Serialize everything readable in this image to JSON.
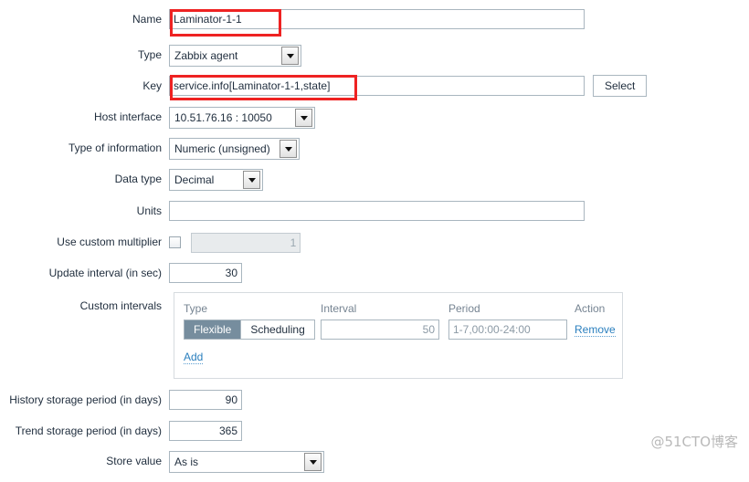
{
  "form": {
    "rows": [
      {
        "label": "Name",
        "value": "Laminator-1-1"
      },
      {
        "label": "Type",
        "value": "Zabbix agent"
      },
      {
        "label": "Key",
        "value": "service.info[Laminator-1-1,state]"
      },
      {
        "label": "Host interface",
        "value": "10.51.76.16 : 10050"
      },
      {
        "label": "Type of information",
        "value": "Numeric (unsigned)"
      },
      {
        "label": "Data type",
        "value": "Decimal"
      },
      {
        "label": "Units",
        "value": ""
      },
      {
        "label": "Use custom multiplier",
        "value": "1"
      },
      {
        "label": "Update interval (in sec)",
        "value": "30"
      },
      {
        "label": "Custom intervals",
        "value": ""
      },
      {
        "label": "History storage period (in days)",
        "value": "90"
      },
      {
        "label": "Trend storage period (in days)",
        "value": "365"
      },
      {
        "label": "Store value",
        "value": "As is"
      }
    ],
    "key_select_button": "Select",
    "units_placeholder": "",
    "name_placeholder": ""
  },
  "custom_intervals": {
    "headers": [
      "Type",
      "Interval",
      "Period",
      "Action"
    ],
    "rows": [
      {
        "type_options": [
          "Flexible",
          "Scheduling"
        ],
        "type_selected": "Flexible",
        "interval": "",
        "interval_placeholder": "50",
        "period": "",
        "period_placeholder": "1-7,00:00-24:00",
        "action": "Remove"
      }
    ],
    "add_label": "Add"
  },
  "icons": {
    "dropdown": "chevron-down-icon",
    "checkbox": "checkbox-unchecked-icon"
  },
  "colors": {
    "highlight": "#ee2222",
    "segment_active": "#768d9e",
    "link": "#2a7fbe"
  },
  "watermark": {
    "text": "@51CTO博客"
  }
}
